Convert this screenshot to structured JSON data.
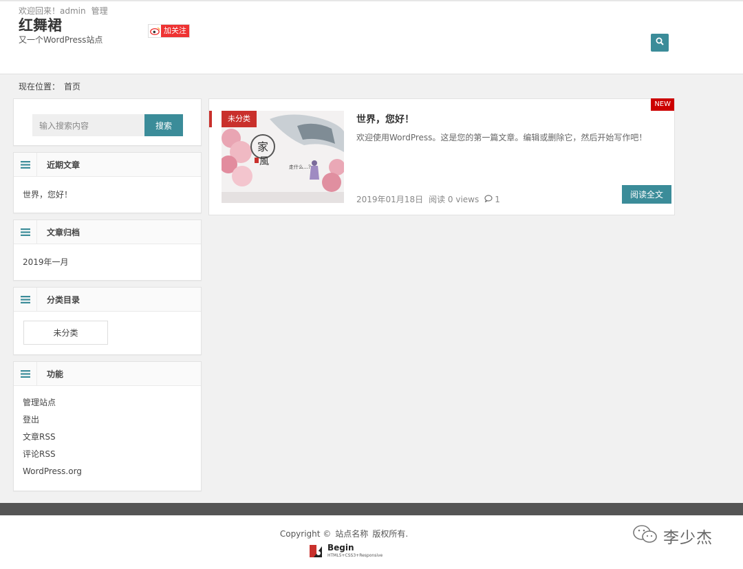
{
  "header": {
    "welcome": "欢迎回来！admin",
    "manage": "管理",
    "site_title": "红舞裙",
    "site_desc": "又一个WordPress站点",
    "follow_label": "加关注"
  },
  "breadcrumb": {
    "label": "现在位置：",
    "current": "首页"
  },
  "search": {
    "placeholder": "输入搜索内容",
    "button": "搜索"
  },
  "widgets": {
    "recent": {
      "title": "近期文章",
      "items": [
        "世界，您好！"
      ]
    },
    "archive": {
      "title": "文章归档",
      "items": [
        "2019年一月"
      ]
    },
    "category": {
      "title": "分类目录",
      "items": [
        "未分类"
      ]
    },
    "meta": {
      "title": "功能",
      "items": [
        "管理站点",
        "登出",
        "文章RSS",
        "评论RSS",
        "WordPress.org"
      ]
    }
  },
  "post": {
    "category": "未分类",
    "badge": "NEW",
    "title": "世界，您好！",
    "excerpt": "欢迎使用WordPress。这是您的第一篇文章。编辑或删除它，然后开始写作吧！",
    "date": "2019年01月18日",
    "views": "阅读 0 views",
    "comments": "1",
    "read_more": "阅读全文"
  },
  "footer": {
    "copyright": "Copyright ©",
    "site_name": "站点名称",
    "rights": "版权所有.",
    "logo_name": "Begin",
    "logo_sub": "HTML5+CSS3+Responsive"
  },
  "watermark": {
    "name": "李少杰"
  },
  "colors": {
    "accent": "#3b8c99",
    "red": "#c9302c",
    "footer_bar": "#555555"
  },
  "icons": [
    "search-icon",
    "menu-icon",
    "weibo-icon",
    "comment-icon",
    "wechat-icon"
  ]
}
